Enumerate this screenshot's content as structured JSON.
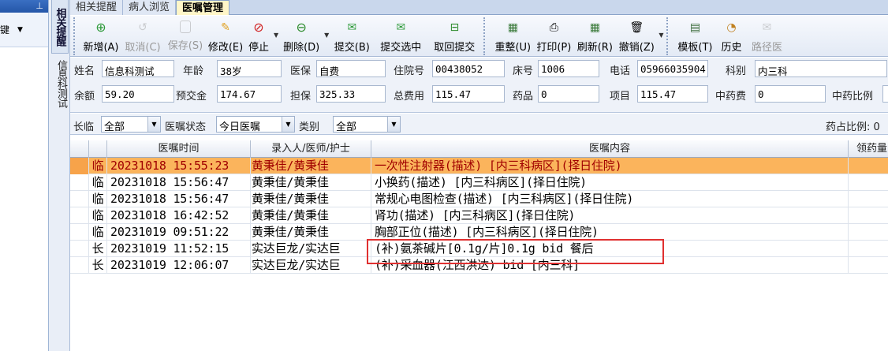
{
  "left_panel": {
    "dropdown_label": "键",
    "pin_icon": "pin-icon"
  },
  "side_tab": {
    "label": "相关提醒"
  },
  "side_patient_label": "信息科测试",
  "tabs": [
    {
      "label": "相关提醒"
    },
    {
      "label": "病人浏览"
    },
    {
      "label": "医嘱管理"
    }
  ],
  "toolbar": [
    {
      "label": "新增(A)",
      "icon": "add-icon",
      "color": "#2e9a3a"
    },
    {
      "label": "取消(C)",
      "icon": "undo-icon",
      "color": "#888888"
    },
    {
      "label": "保存(S)",
      "icon": "save-icon",
      "color": "#888888"
    },
    {
      "label": "修改(E)",
      "icon": "edit-icon",
      "color": "#e0a020"
    },
    {
      "label": "停止",
      "icon": "stop-icon",
      "color": "#d02020"
    },
    {
      "label": "删除(D)",
      "icon": "delete-icon",
      "color": "#2a8a2a"
    },
    {
      "label": "提交(B)",
      "icon": "submit-icon",
      "color": "#2e9a3a"
    },
    {
      "label": "提交选中",
      "icon": "submit-selected-icon",
      "color": "#2e9a3a"
    },
    {
      "label": "取回提交",
      "icon": "retrieve-icon",
      "color": "#2a8a2a"
    },
    {
      "label": "重整(U)",
      "icon": "reorganize-icon",
      "color": "#3a7a3a"
    },
    {
      "label": "打印(P)",
      "icon": "print-icon",
      "color": "#444444"
    },
    {
      "label": "刷新(R)",
      "icon": "refresh-icon",
      "color": "#3a7a3a"
    },
    {
      "label": "撤销(Z)",
      "icon": "revoke-icon",
      "color": "#555555"
    },
    {
      "label": "模板(T)",
      "icon": "template-icon",
      "color": "#3a6a3a"
    },
    {
      "label": "历史",
      "icon": "history-icon",
      "color": "#c08020"
    },
    {
      "label": "路径医",
      "icon": "pathway-icon",
      "color": "#888888"
    }
  ],
  "patient": {
    "name_label": "姓名",
    "name": "信息科测试",
    "age_label": "年龄",
    "age": "38岁",
    "insurance_label": "医保",
    "insurance": "自费",
    "admission_no_label": "住院号",
    "admission_no": "00438052",
    "bed_label": "床号",
    "bed": "1006",
    "phone_label": "电话",
    "phone": "05966035904",
    "dept_label": "科别",
    "dept": "内三科",
    "balance_label": "余额",
    "balance": "59.20",
    "prepaid_label": "预交金",
    "prepaid": "174.67",
    "guarantee_label": "担保",
    "guarantee": "325.33",
    "total_label": "总费用",
    "total": "115.47",
    "drug_label": "药品",
    "drug": "0",
    "item_label": "项目",
    "item": "115.47",
    "herbal_label": "中药费",
    "herbal": "0",
    "herbal_ratio_label": "中药比例"
  },
  "filters": {
    "type_label": "长临",
    "type_value": "全部",
    "status_label": "医嘱状态",
    "status_value": "今日医嘱",
    "category_label": "类别",
    "category_value": "全部",
    "drug_ratio_label": "药占比例: 0"
  },
  "grid": {
    "headers": [
      "医嘱时间",
      "录入人/医师/护士",
      "医嘱内容",
      "领药量"
    ],
    "rows": [
      {
        "type": "临",
        "time": "20231018 15:55:23",
        "who": "黄秉佳/黄秉佳",
        "content": "一次性注射器(描述)   [内三科病区](择日住院)",
        "selected": true
      },
      {
        "type": "临",
        "time": "20231018 15:56:47",
        "who": "黄秉佳/黄秉佳",
        "content": "小换药(描述)   [内三科病区](择日住院)",
        "selected": false
      },
      {
        "type": "临",
        "time": "20231018 15:56:47",
        "who": "黄秉佳/黄秉佳",
        "content": "常规心电图检查(描述)   [内三科病区](择日住院)",
        "selected": false
      },
      {
        "type": "临",
        "time": "20231018 16:42:52",
        "who": "黄秉佳/黄秉佳",
        "content": "肾功(描述)   [内三科病区](择日住院)",
        "selected": false
      },
      {
        "type": "临",
        "time": "20231019 09:51:22",
        "who": "黄秉佳/黄秉佳",
        "content": "胸部正位(描述)   [内三科病区](择日住院)",
        "selected": false
      },
      {
        "type": "长",
        "time": "20231019 11:52:15",
        "who": "实达巨龙/实达巨",
        "content": "(补)氨茶碱片[0.1g/片]0.1g bid 餐后",
        "selected": false
      },
      {
        "type": "长",
        "time": "20231019 12:06:07",
        "who": "实达巨龙/实达巨",
        "content": "(补)采血器(江西洪达) bid  [内三科]",
        "selected": false
      }
    ]
  }
}
